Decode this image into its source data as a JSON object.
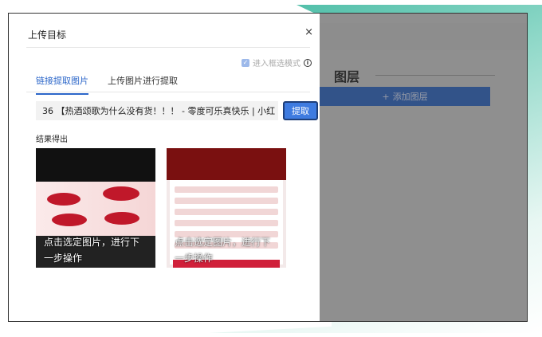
{
  "dialog": {
    "title": "上传目标",
    "close_label": "×",
    "mode_label": "进入框选模式",
    "tabs": [
      {
        "label": "链接提取图片",
        "active": true
      },
      {
        "label": "上传图片进行提取",
        "active": false
      }
    ],
    "url_value": "36 【热酒颂歌为什么没有货！！！ - 零度可乐真快乐 | 小红",
    "extract_label": "提取",
    "result_label": "结果得出",
    "cards": [
      {
        "caption": "点击选定图片，进行下一步操作"
      },
      {
        "caption": "点击选定图片，进行下一步操作"
      }
    ]
  },
  "background_app": {
    "layer_title": "图层",
    "add_layer_label": "添加图层",
    "add_icon": "+"
  },
  "colors": {
    "accent": "#2b66c9",
    "button": "#3e7be0",
    "deco_teal": "#3fb8a0"
  }
}
